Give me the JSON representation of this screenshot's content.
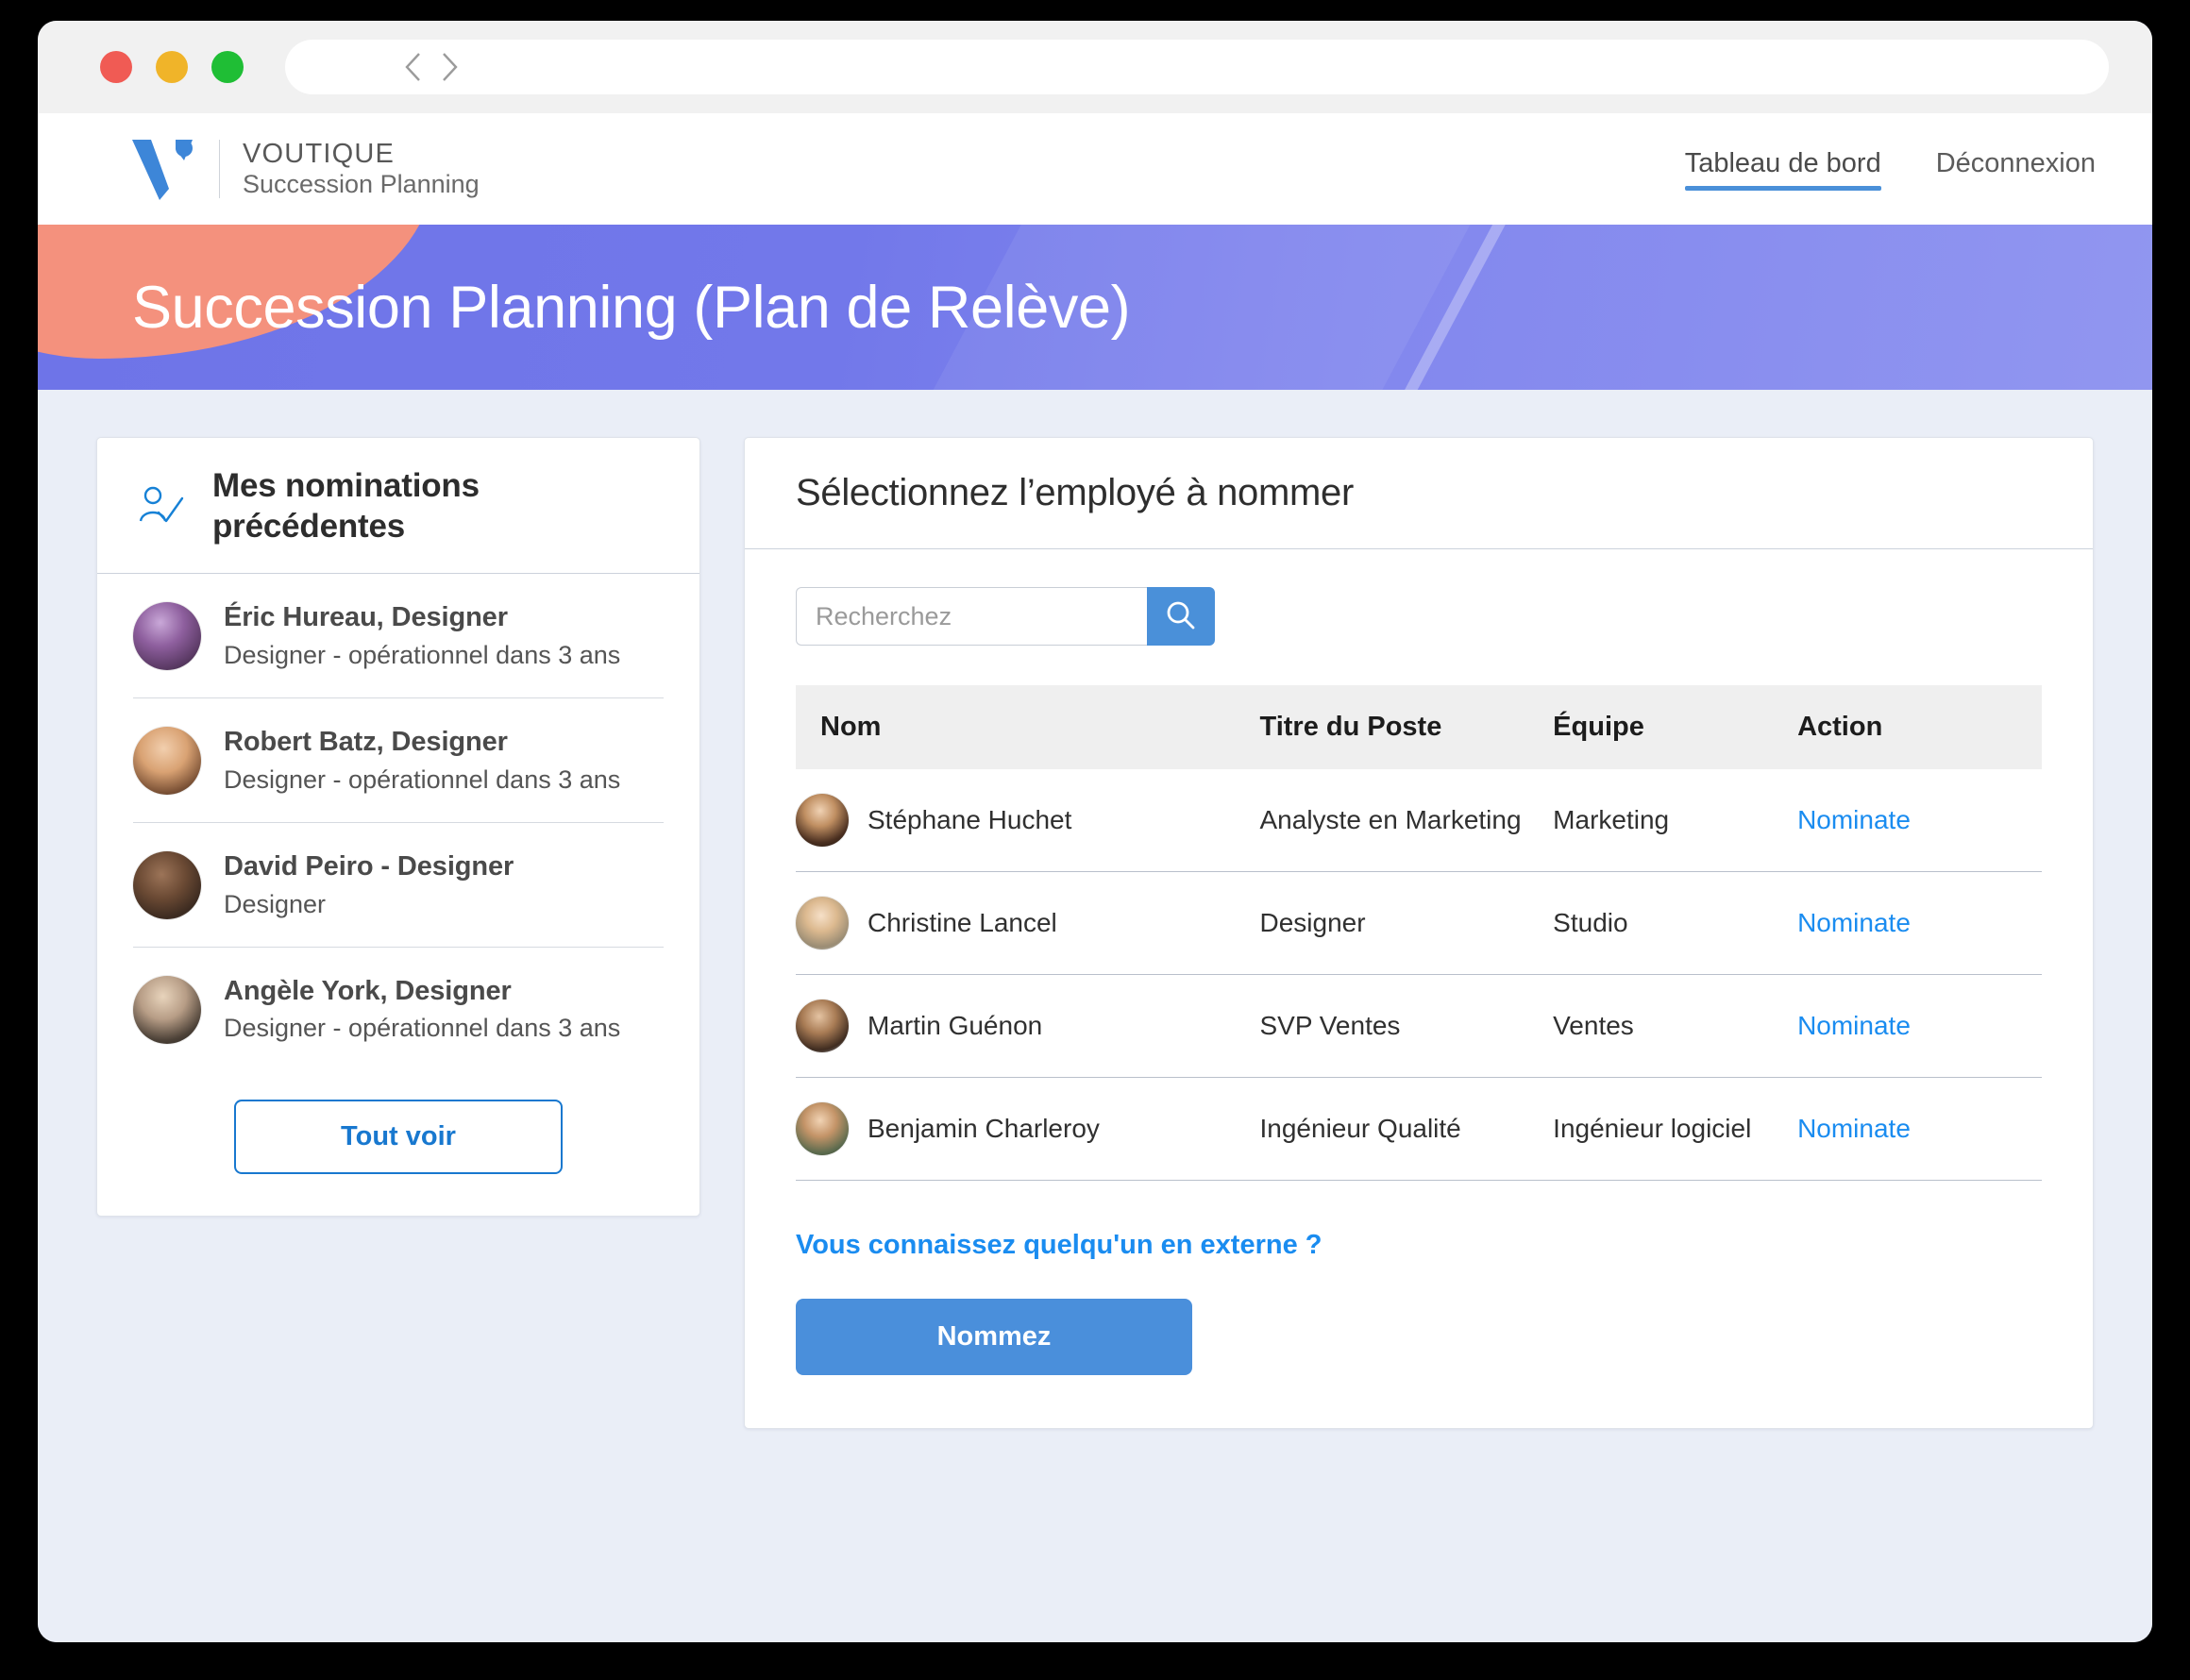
{
  "browser": {
    "url_value": "",
    "url_placeholder": "",
    "back_icon": "chevron-left-icon",
    "forward_icon": "chevron-right-icon",
    "lights": [
      "close-light",
      "minimize-light",
      "maximize-light"
    ]
  },
  "header": {
    "brand_line1": "VOUTIQUE",
    "brand_line2": "Succession Planning",
    "nav": [
      {
        "label": "Tableau de bord",
        "active": true
      },
      {
        "label": "Déconnexion",
        "active": false
      }
    ]
  },
  "hero": {
    "title": "Succession Planning (Plan de Relève)"
  },
  "left_panel": {
    "icon": "person-check-icon",
    "title": "Mes nominations précédentes",
    "items": [
      {
        "name": "Éric Hureau, Designer",
        "detail": "Designer - opérationnel dans 3 ans"
      },
      {
        "name": "Robert Batz, Designer",
        "detail": "Designer - opérationnel dans 3 ans"
      },
      {
        "name": "David Peiro - Designer",
        "detail": "Designer"
      },
      {
        "name": "Angèle York, Designer",
        "detail": "Designer - opérationnel dans 3 ans"
      }
    ],
    "view_all_label": "Tout voir"
  },
  "right_panel": {
    "title": "Sélectionnez l’employé à nommer",
    "search": {
      "value": "",
      "placeholder": "Recherchez",
      "button_icon": "search-icon"
    },
    "table": {
      "columns": [
        "Nom",
        "Titre du Poste",
        "Équipe",
        "Action"
      ],
      "rows": [
        {
          "name": "Stéphane Huchet",
          "title": "Analyste en Marketing",
          "team": "Marketing",
          "action": "Nominate"
        },
        {
          "name": "Christine Lancel",
          "title": "Designer",
          "team": "Studio",
          "action": "Nominate"
        },
        {
          "name": "Martin Guénon",
          "title": "SVP Ventes",
          "team": "Ventes",
          "action": "Nominate"
        },
        {
          "name": "Benjamin Charleroy",
          "title": "Ingénieur Qualité",
          "team": "Ingénieur logiciel",
          "action": "Nominate"
        }
      ]
    },
    "external_link": "Vous connaissez quelqu'un en externe ?",
    "submit_label": "Nommez"
  },
  "colors": {
    "accent_blue": "#4a90d9",
    "link_blue": "#1a8cf0",
    "outline_blue": "#1878cf",
    "hero_purple": "#7278ea",
    "hero_coral": "#f4917d",
    "page_bg": "#eaeef7"
  }
}
